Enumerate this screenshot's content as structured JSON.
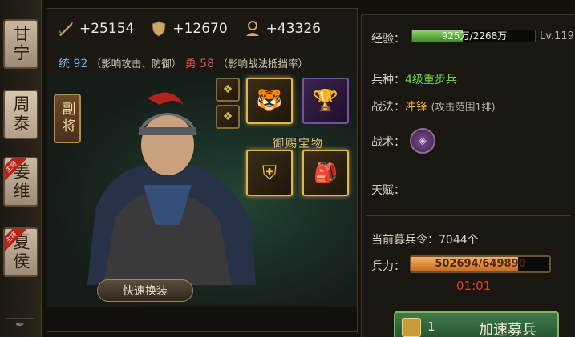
{
  "roster": {
    "heroes": [
      {
        "name": "甘宁",
        "badge": ""
      },
      {
        "name": "周泰",
        "badge": ""
      },
      {
        "name": "姜维",
        "badge": "主将"
      },
      {
        "name": "夏侯",
        "badge": "主将"
      }
    ]
  },
  "stats": {
    "attack": "+25154",
    "defense": "+12670",
    "troops": "+43326"
  },
  "attributes": {
    "command_label": "统",
    "command_value": "92",
    "command_note": "（影响攻击、防御）",
    "courage_label": "勇",
    "courage_value": "58",
    "courage_note": "（影响战法抵挡率）"
  },
  "portrait": {
    "deputy_label": "副将",
    "quick_swap_label": "快速换装",
    "treasure_label": "御赐宝物"
  },
  "info": {
    "exp_label": "经验：",
    "exp_text": "925万/2268万",
    "exp_progress": 0.41,
    "level_text": "Lv.119",
    "troop_type_label": "兵种：",
    "troop_type_value": "4级重步兵",
    "tactic_label": "战法：",
    "tactic_value": "冲锋",
    "tactic_note": "(攻击范围1排)",
    "strategy_label": "战术：",
    "talent_label": "天赋：",
    "recruit_order_label": "当前募兵令：",
    "recruit_order_value": "7044个",
    "troop_label": "兵力：",
    "troop_text": "502694/649890",
    "troop_progress": 0.7735,
    "timer": "01:01",
    "speed_count": "1",
    "speed_label": "加速募兵"
  },
  "colors": {
    "accent_gold": "#e2b54d",
    "exp_green": "#3e8d2a",
    "troop_orange": "#c86a1f",
    "timer_red": "#e03a2a",
    "command_blue": "#6fb3e6",
    "courage_red": "#e0533f"
  }
}
